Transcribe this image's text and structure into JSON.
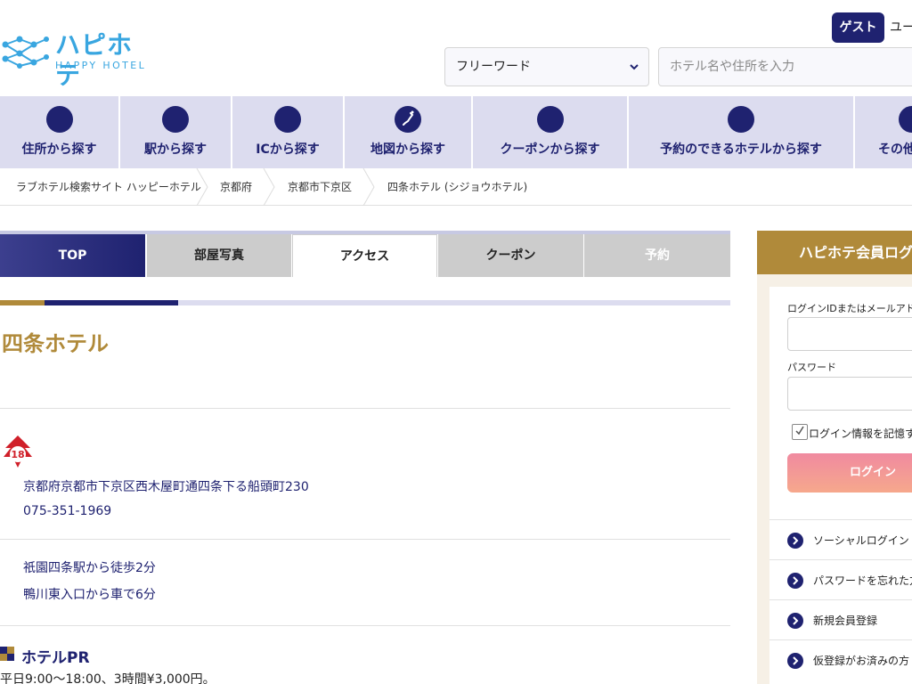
{
  "header": {
    "logo_jp": "ハピホテ",
    "logo_en": "HAPPY HOTEL",
    "guest_label": "ゲスト",
    "user_label": "ユー",
    "select_value": "フリーワード",
    "search_placeholder": "ホテル名や住所を入力"
  },
  "nav": {
    "items": [
      {
        "label": "住所から探す"
      },
      {
        "label": "駅から探す"
      },
      {
        "label": "ICから探す"
      },
      {
        "label": "地図から探す"
      },
      {
        "label": "クーポンから探す"
      },
      {
        "label": "予約のできるホテルから探す"
      },
      {
        "label": "その他"
      }
    ]
  },
  "breadcrumb": [
    "ラブホテル検索サイト ハッピーホテル",
    "京都府",
    "京都市下京区",
    "四条ホテル (シジョウホテル)"
  ],
  "tabs": {
    "top": "TOP",
    "photos": "部屋写真",
    "access": "アクセス",
    "coupon": "クーポン",
    "reserve": "予約"
  },
  "hotel": {
    "name": "四条ホテル",
    "r18_badge": "18",
    "address": "京都府京都市下京区西木屋町通四条下る船頭町230",
    "phone": "075-351-1969",
    "access": [
      "祇園四条駅から徒歩2分",
      "鴨川東入口から車で6分"
    ],
    "pr_title": "ホテルPR",
    "pr_text": "平日9:00〜18:00、3時間¥3,000円。"
  },
  "login": {
    "title": "ハピホテ会員ログ",
    "id_label": "ログインIDまたはメールアドレ",
    "password_label": "パスワード",
    "remember_label": "ログイン情報を記憶す",
    "button": "ログイン",
    "links": [
      "ソーシャルログイン",
      "パスワードを忘れた方",
      "新規会員登録",
      "仮登録がお済みの方"
    ]
  },
  "colors": {
    "navy": "#1f2270",
    "gold": "#b08a3a",
    "nav_bg": "#dcdcef",
    "logo_blue": "#39a6e0"
  }
}
